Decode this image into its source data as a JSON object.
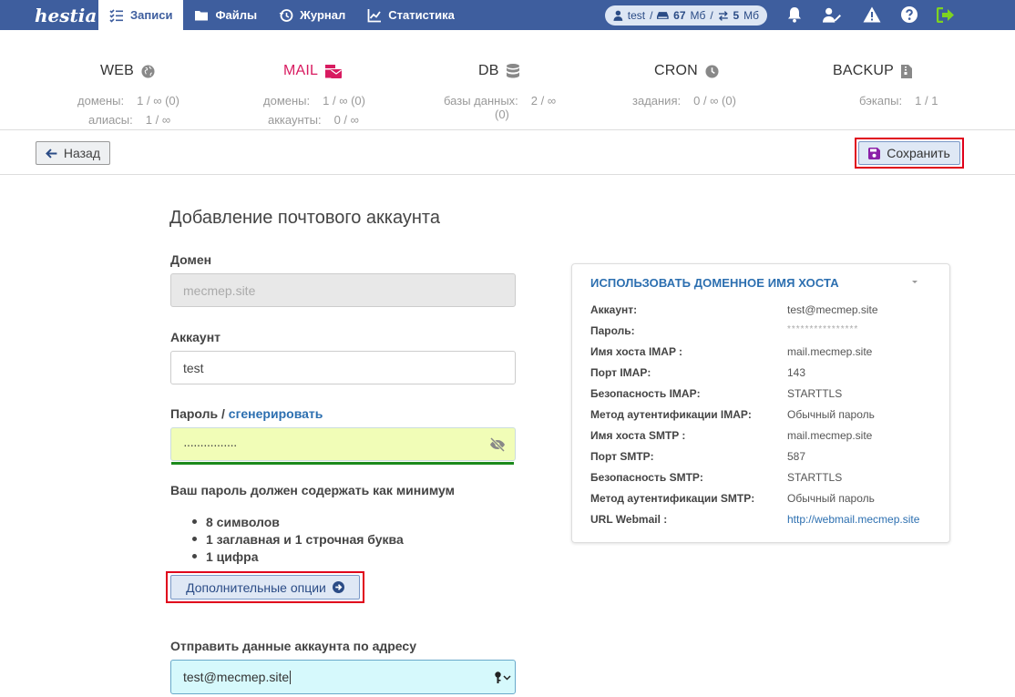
{
  "app": {
    "logo": "hestia"
  },
  "nav": {
    "items": [
      {
        "label": "Записи",
        "icon": "list-check-icon",
        "active": true
      },
      {
        "label": "Файлы",
        "icon": "folder-icon",
        "active": false
      },
      {
        "label": "Журнал",
        "icon": "history-icon",
        "active": false
      },
      {
        "label": "Статистика",
        "icon": "chart-line-icon",
        "active": false
      }
    ],
    "user": {
      "name": "test",
      "sep": "/",
      "disk": "67",
      "disk_unit": "Мб",
      "bw": "5",
      "bw_unit": "Мб"
    }
  },
  "stats": {
    "web": {
      "title": "WEB",
      "rows": [
        {
          "k": "домены:",
          "v": "1 / ∞ (0)"
        },
        {
          "k": "алиасы:",
          "v": "1 / ∞"
        }
      ]
    },
    "mail": {
      "title": "MAIL",
      "rows": [
        {
          "k": "домены:",
          "v": "1 / ∞ (0)"
        },
        {
          "k": "аккаунты:",
          "v": "0 / ∞"
        }
      ]
    },
    "db": {
      "title": "DB",
      "rows": [
        {
          "k": "базы данных:",
          "v": "2 / ∞"
        },
        {
          "k": "",
          "v": "(0)"
        }
      ]
    },
    "cron": {
      "title": "CRON",
      "rows": [
        {
          "k": "задания:",
          "v": "0 / ∞ (0)"
        }
      ]
    },
    "backup": {
      "title": "BACKUP",
      "rows": [
        {
          "k": "бэкапы:",
          "v": "1 / 1"
        }
      ]
    }
  },
  "toolbar": {
    "back_label": "Назад",
    "save_label": "Сохранить"
  },
  "form": {
    "title": "Добавление почтового аккаунта",
    "domain_label": "Домен",
    "domain_value": "mecmep.site",
    "account_label": "Аккаунт",
    "account_value": "test",
    "password_label": "Пароль /",
    "password_generate": "сгенерировать",
    "password_value": "················",
    "req_title": "Ваш пароль должен содержать как минимум",
    "req_items": [
      "8 символов",
      "1 заглавная и 1 строчная буква",
      "1 цифра"
    ],
    "options_label": "Дополнительные опции",
    "send_label": "Отправить данные аккаунта по адресу",
    "send_value": "test@mecmep.site"
  },
  "panel": {
    "title": "ИСПОЛЬЗОВАТЬ ДОМЕННОЕ ИМЯ ХОСТА",
    "rows": [
      {
        "k": "Аккаунт:",
        "v": "test@mecmep.site"
      },
      {
        "k": "Пароль:",
        "v": "****************"
      },
      {
        "k": "Имя хоста IMAP :",
        "v": "mail.mecmep.site"
      },
      {
        "k": "Порт IMAP:",
        "v": "143"
      },
      {
        "k": "Безопасность IMAP:",
        "v": "STARTTLS"
      },
      {
        "k": "Метод аутентификации IMAP:",
        "v": "Обычный пароль"
      },
      {
        "k": "Имя хоста SMTP :",
        "v": "mail.mecmep.site"
      },
      {
        "k": "Порт SMTP:",
        "v": "587"
      },
      {
        "k": "Безопасность SMTP:",
        "v": "STARTTLS"
      },
      {
        "k": "Метод аутентификации SMTP:",
        "v": "Обычный пароль"
      },
      {
        "k": "URL Webmail :",
        "v": "http://webmail.mecmep.site"
      }
    ]
  },
  "colors": {
    "nav_bg": "#3e5e9e",
    "mail_accent": "#d81b60",
    "link": "#2c6fb0",
    "highlight": "#e0001b"
  }
}
